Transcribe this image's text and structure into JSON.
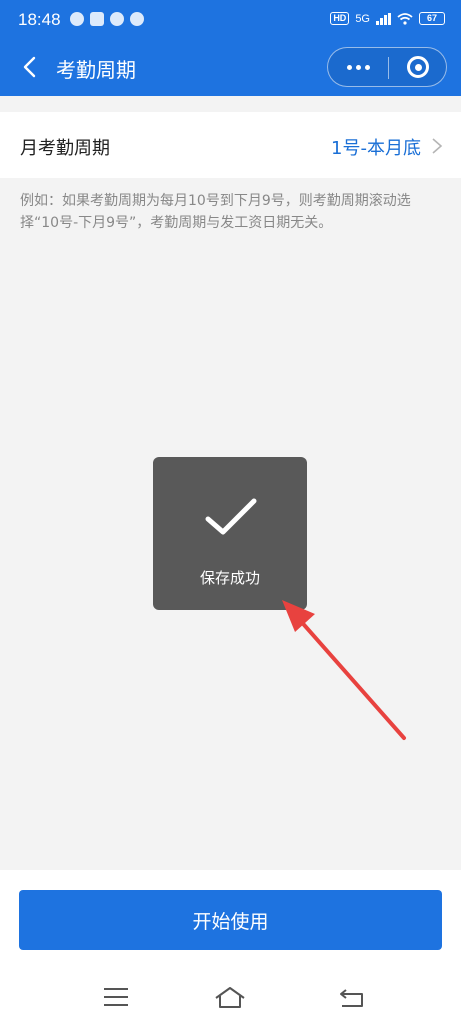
{
  "status_bar": {
    "time": "18:48",
    "hd": "HD",
    "network": "5G",
    "battery": "67"
  },
  "nav": {
    "title": "考勤周期"
  },
  "setting": {
    "label": "月考勤周期",
    "value": "1号-本月底",
    "description": "例如：如果考勤周期为每月10号到下月9号，则考勤周期滚动选择“10号-下月9号”，考勤周期与发工资日期无关。"
  },
  "toast": {
    "message": "保存成功"
  },
  "footer": {
    "start_label": "开始使用"
  },
  "colors": {
    "primary": "#1e73e0",
    "link": "#1a6fd6",
    "annotation_arrow": "#e8423f"
  }
}
